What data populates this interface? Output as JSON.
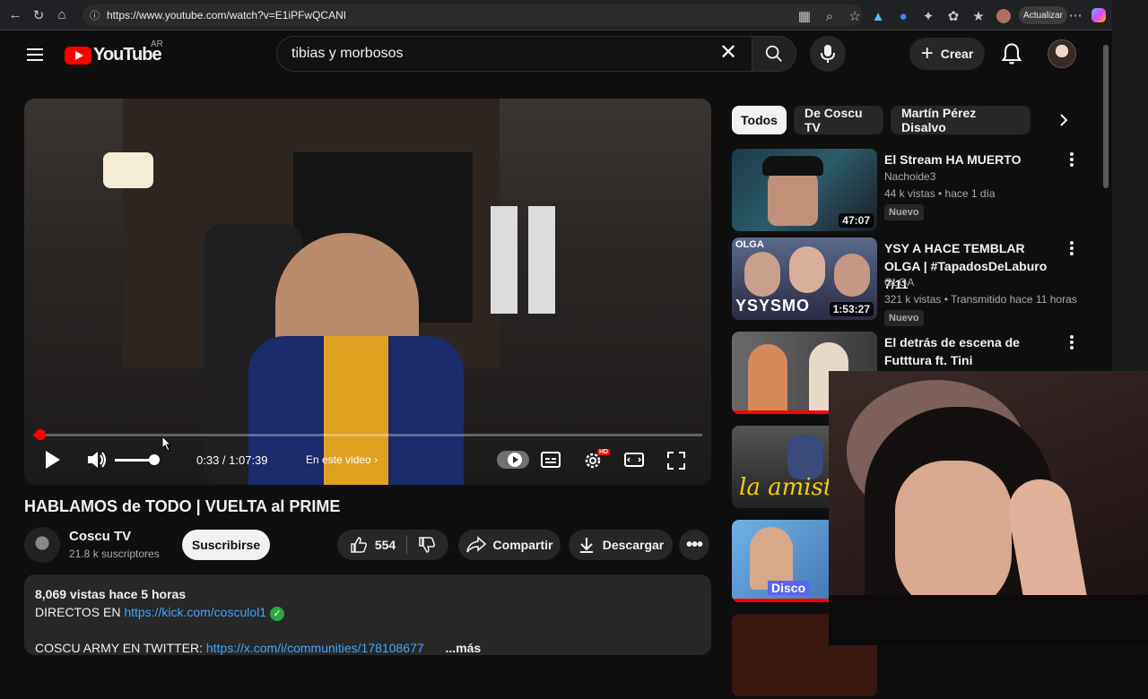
{
  "browser": {
    "url": "https://www.youtube.com/watch?v=E1iPFwQCANI",
    "update_label": "Actualizar"
  },
  "header": {
    "logo_text": "YouTube",
    "region": "AR",
    "search_value": "tibias y morbosos",
    "create_label": "Crear"
  },
  "player": {
    "time": "0:33 / 1:07:39",
    "chapter_label": "En este video",
    "progress_fraction": 0.008,
    "volume_fraction": 1.0
  },
  "video": {
    "title": "HABLAMOS de TODO | VUELTA al PRIME",
    "channel": "Coscu TV",
    "subscribers": "21.8 k suscriptores",
    "subscribe_label": "Suscribirse",
    "likes": "554",
    "share_label": "Compartir",
    "download_label": "Descargar",
    "description": {
      "stats": "8,069 vistas  hace 5 horas",
      "line1_prefix": "DIRECTOS EN ",
      "line1_link": "https://kick.com/cosculol1",
      "line2_prefix": "COSCU ARMY EN TWITTER: ",
      "line2_link": "https://x.com/i/communities/178108677",
      "more": "...más"
    }
  },
  "chips": [
    "Todos",
    "De Coscu TV",
    "Martín Pérez Disalvo"
  ],
  "recommendations": [
    {
      "title": "El Stream HA MUERTO",
      "channel": "Nachoide3",
      "meta": "44 k vistas • hace 1 día",
      "badge": "Nuevo",
      "duration": "47:07"
    },
    {
      "title": "YSY A HACE TEMBLAR OLGA | #TapadosDeLaburo 7/11",
      "channel": "OLGA",
      "meta": "321 k vistas • Transmitido hace 11 horas",
      "badge": "Nuevo",
      "duration": "1:53:27",
      "thumb_text": "YSYSMO",
      "thumb_tag": "OLGA"
    },
    {
      "title": "El detrás de escena de Futttura ft. Tini",
      "channel": "",
      "meta": "",
      "badge": "",
      "duration": ""
    },
    {
      "title": "",
      "thumb_text": "la amist"
    },
    {
      "title": "",
      "thumb_text": "Disco"
    }
  ]
}
